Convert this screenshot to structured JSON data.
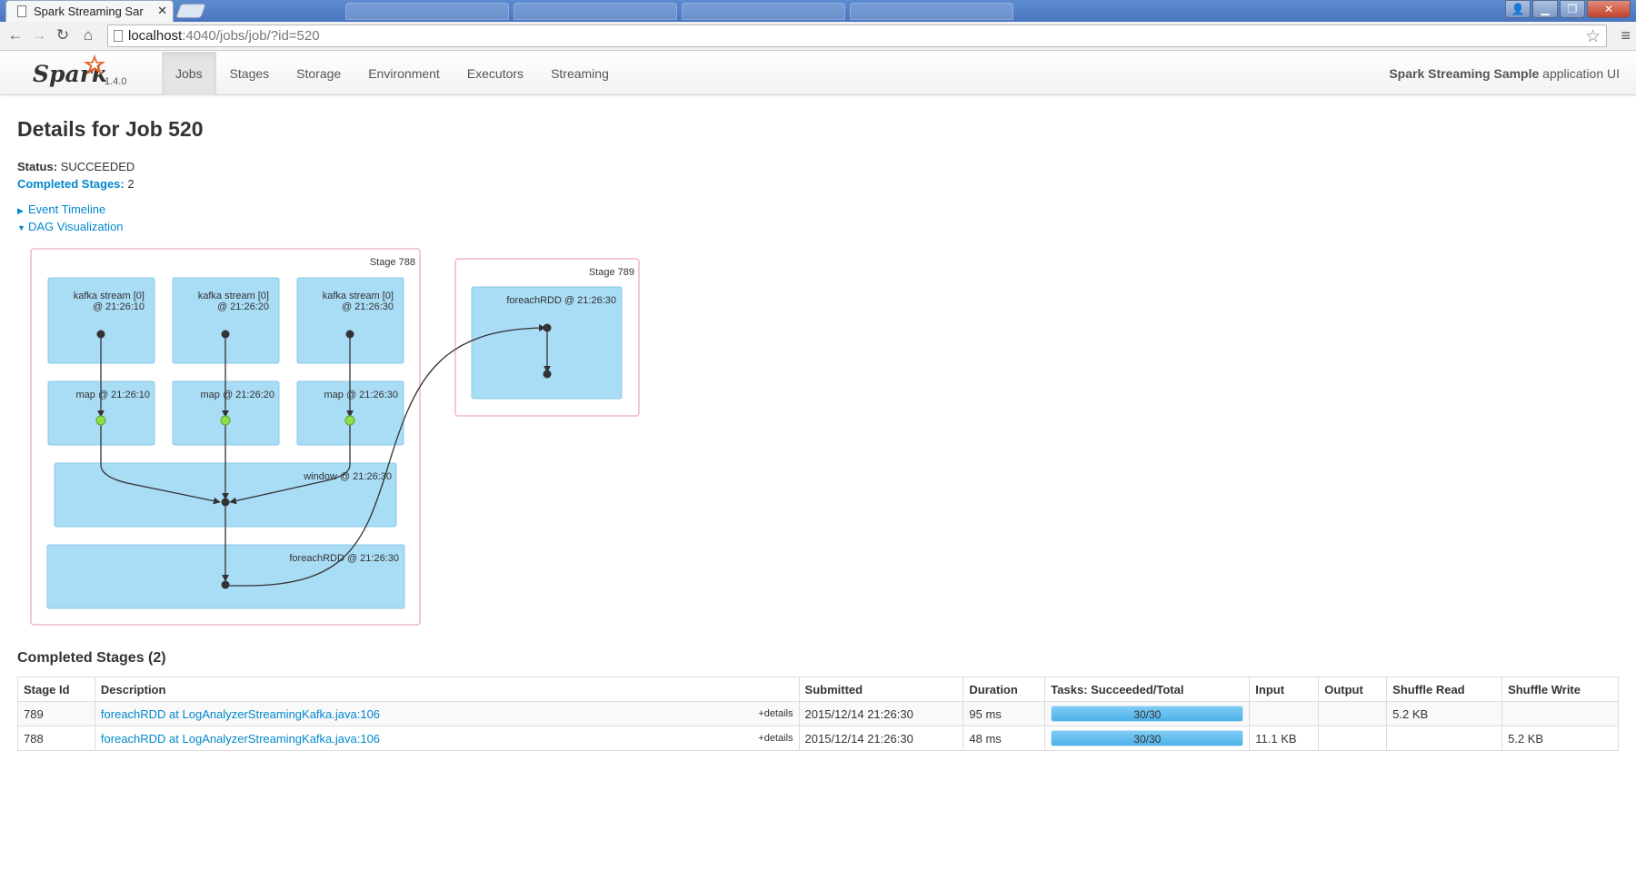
{
  "browser": {
    "tab_title": "Spark Streaming Sar",
    "url_host": "localhost",
    "url_rest": ":4040/jobs/job/?id=520"
  },
  "navbar": {
    "brand": "Spark",
    "version": "1.4.0",
    "items": [
      {
        "label": "Jobs",
        "active": true
      },
      {
        "label": "Stages"
      },
      {
        "label": "Storage"
      },
      {
        "label": "Environment"
      },
      {
        "label": "Executors"
      },
      {
        "label": "Streaming"
      }
    ],
    "app_name": "Spark Streaming Sample",
    "app_suffix": "application UI"
  },
  "page": {
    "title": "Details for Job 520",
    "status_label": "Status:",
    "status_value": "SUCCEEDED",
    "completed_label": "Completed Stages:",
    "completed_value": "2",
    "event_timeline": "Event Timeline",
    "dag_visualization": "DAG Visualization"
  },
  "dag": {
    "stages": [
      {
        "label": "Stage 788"
      },
      {
        "label": "Stage 789"
      }
    ],
    "nodes": {
      "k1": [
        "kafka stream [0]",
        "@ 21:26:10"
      ],
      "k2": [
        "kafka stream [0]",
        "@ 21:26:20"
      ],
      "k3": [
        "kafka stream [0]",
        "@ 21:26:30"
      ],
      "m1": "map @ 21:26:10",
      "m2": "map @ 21:26:20",
      "m3": "map @ 21:26:30",
      "w": "window @ 21:26:30",
      "f788": "foreachRDD @ 21:26:30",
      "f789": "foreachRDD @ 21:26:30"
    },
    "colors": {
      "node_fill": "#a9dcf5",
      "node_stroke": "#8cc8ea",
      "stage_stroke": "#f3b7c2",
      "cached_dot": "#8be04a"
    }
  },
  "completed_stages": {
    "title": "Completed Stages (2)",
    "columns": [
      "Stage Id",
      "Description",
      "Submitted",
      "Duration",
      "Tasks: Succeeded/Total",
      "Input",
      "Output",
      "Shuffle Read",
      "Shuffle Write"
    ],
    "rows": [
      {
        "stage_id": "789",
        "description": "foreachRDD at LogAnalyzerStreamingKafka.java:106",
        "details": "+details",
        "submitted": "2015/12/14 21:26:30",
        "duration": "95 ms",
        "tasks": "30/30",
        "tasks_fraction": 1.0,
        "input": "",
        "output": "",
        "shuffle_read": "5.2 KB",
        "shuffle_write": ""
      },
      {
        "stage_id": "788",
        "description": "foreachRDD at LogAnalyzerStreamingKafka.java:106",
        "details": "+details",
        "submitted": "2015/12/14 21:26:30",
        "duration": "48 ms",
        "tasks": "30/30",
        "tasks_fraction": 1.0,
        "input": "11.1 KB",
        "output": "",
        "shuffle_read": "",
        "shuffle_write": "5.2 KB"
      }
    ]
  }
}
